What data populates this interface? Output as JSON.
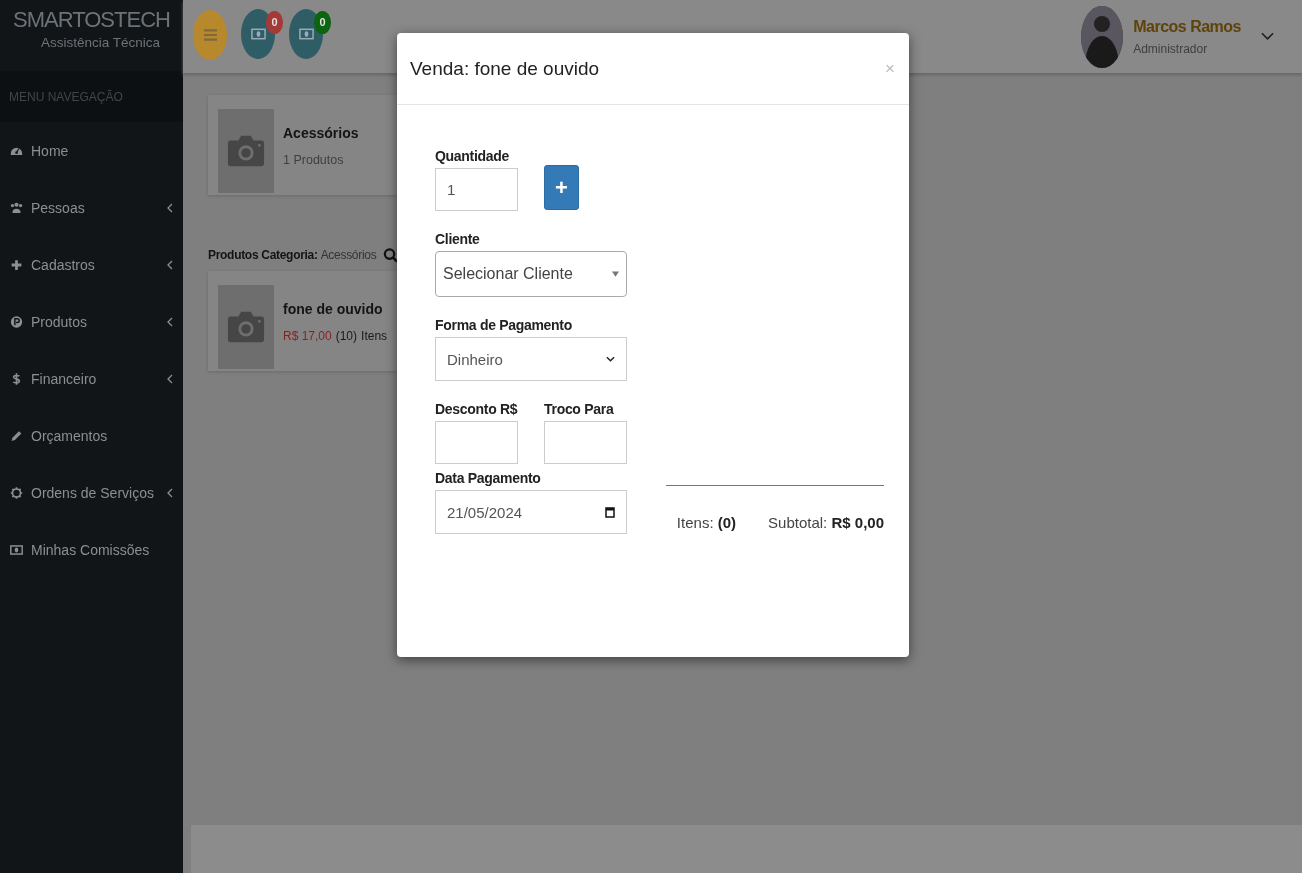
{
  "brand": {
    "title": "SMARTOSTECH",
    "subtitle": "Assistência Técnica"
  },
  "sidebar": {
    "heading": "MENU NAVEGAÇÃO",
    "items": [
      {
        "label": "Home",
        "kind": "dashboard",
        "has_submenu": false
      },
      {
        "label": "Pessoas",
        "kind": "users",
        "has_submenu": true
      },
      {
        "label": "Cadastros",
        "kind": "plus",
        "has_submenu": true
      },
      {
        "label": "Produtos",
        "kind": "p-circle",
        "has_submenu": true
      },
      {
        "label": "Financeiro",
        "kind": "dollar",
        "has_submenu": true
      },
      {
        "label": "Orçamentos",
        "kind": "pencil",
        "has_submenu": false
      },
      {
        "label": "Ordens de Serviços",
        "kind": "gear",
        "has_submenu": true
      },
      {
        "label": "Minhas Comissões",
        "kind": "money",
        "has_submenu": false
      }
    ]
  },
  "topbar": {
    "notifications": [
      {
        "count": "0",
        "color": "#a33a35"
      },
      {
        "count": "0",
        "color": "#0a6410"
      }
    ],
    "user": {
      "name": "Marcos Ramos",
      "role": "Administrador"
    }
  },
  "category_card": {
    "title": "Acessórios",
    "subtitle": "1 Produtos"
  },
  "products_heading": {
    "label": "Produtos Categoria:",
    "value": "Acessórios"
  },
  "products": [
    {
      "name": "fone de ouvido",
      "price": "R$ 17,00",
      "stock": "(10)",
      "unit": "Itens"
    }
  ],
  "modal": {
    "title": "Venda: fone de ouvido",
    "close": "×",
    "quantity": {
      "label": "Quantidade",
      "value": "1",
      "add": "+"
    },
    "client": {
      "label": "Cliente",
      "placeholder": "Selecionar Cliente"
    },
    "payment": {
      "label": "Forma de Pagamento",
      "value": "Dinheiro"
    },
    "discount": {
      "label": "Desconto R$"
    },
    "change": {
      "label": "Troco Para"
    },
    "date": {
      "label": "Data Pagamento",
      "value": "21/05/2024"
    },
    "summary": {
      "items_label": "Itens:",
      "items_value": "(0)",
      "subtotal_label": "Subtotal:",
      "subtotal_value": "R$ 0,00"
    }
  }
}
